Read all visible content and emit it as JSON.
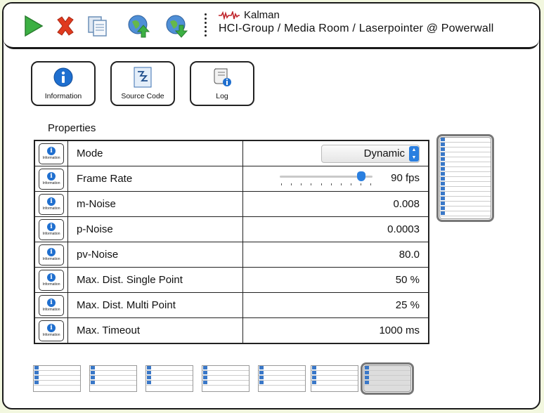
{
  "toolbar": {
    "buttons": [
      {
        "name": "play-button",
        "icon": "play-icon",
        "color": "#3cb043"
      },
      {
        "name": "delete-button",
        "icon": "close-icon",
        "color": "#e03a1e"
      },
      {
        "name": "copy-button",
        "icon": "copy-icon",
        "color": "#6b8fb8"
      },
      {
        "name": "upload-button",
        "icon": "upload-icon",
        "color": "#3cb043"
      },
      {
        "name": "download-button",
        "icon": "download-icon",
        "color": "#3cb043"
      }
    ],
    "app_name": "Kalman",
    "breadcrumb": "HCI-Group / Media Room / Laserpointer @ Powerwall"
  },
  "actions": {
    "information_label": "Information",
    "source_code_label": "Source Code",
    "log_label": "Log"
  },
  "properties": {
    "title": "Properties",
    "info_label": "Information",
    "rows": [
      {
        "name": "Mode",
        "value": "Dynamic",
        "kind": "dropdown"
      },
      {
        "name": "Frame Rate",
        "value": "90 fps",
        "kind": "slider",
        "slider_fraction": 0.92
      },
      {
        "name": "m-Noise",
        "value": "0.008",
        "kind": "text"
      },
      {
        "name": "p-Noise",
        "value": "0.0003",
        "kind": "text"
      },
      {
        "name": "pv-Noise",
        "value": "80.0",
        "kind": "text"
      },
      {
        "name": "Max. Dist. Single Point",
        "value": "50 %",
        "kind": "text"
      },
      {
        "name": "Max. Dist. Multi Point",
        "value": "25 %",
        "kind": "text"
      },
      {
        "name": "Max. Timeout",
        "value": "1000 ms",
        "kind": "text"
      }
    ]
  },
  "colors": {
    "accent": "#2a7fe0",
    "background": "#f2f7df"
  }
}
